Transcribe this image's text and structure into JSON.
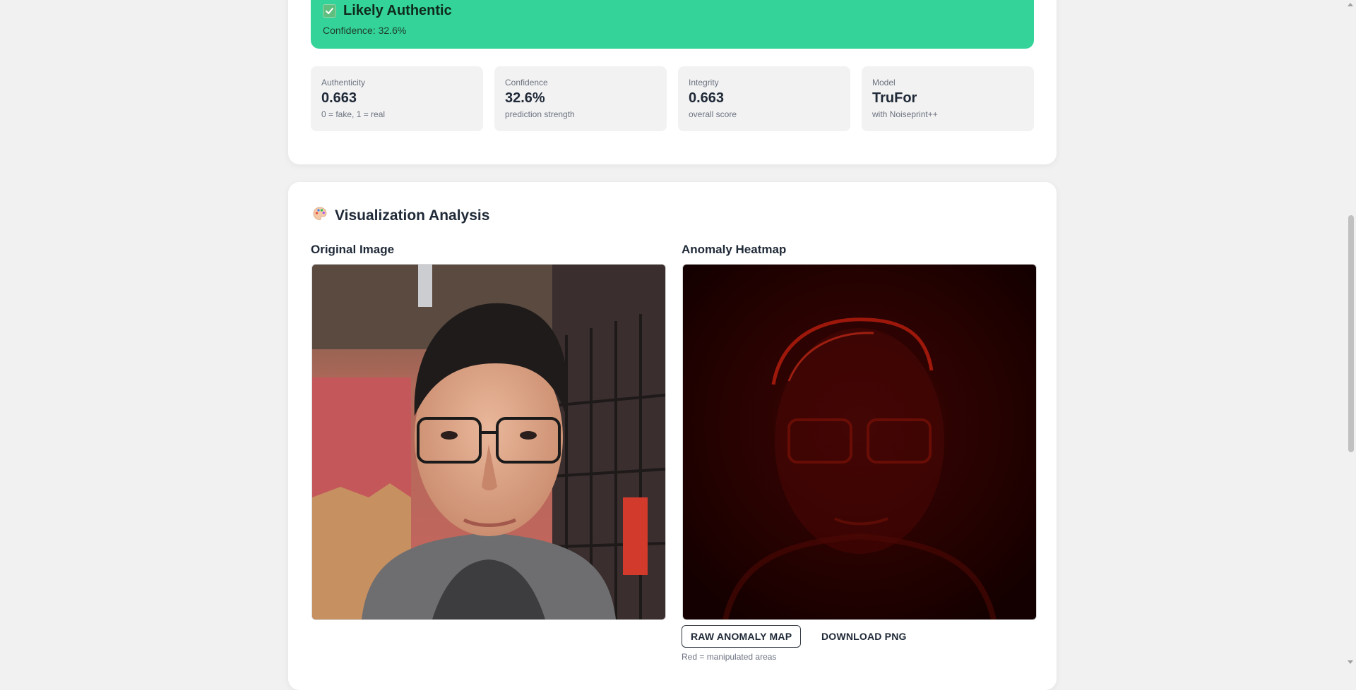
{
  "verdict": {
    "title": "Likely Authentic",
    "confidence_text": "Confidence: 32.6%",
    "icon": "check-icon",
    "color": "#34d399"
  },
  "stats": [
    {
      "label": "Authenticity",
      "value": "0.663",
      "sub": "0 = fake, 1 = real"
    },
    {
      "label": "Confidence",
      "value": "32.6%",
      "sub": "prediction strength"
    },
    {
      "label": "Integrity",
      "value": "0.663",
      "sub": "overall score"
    },
    {
      "label": "Model",
      "value": "TruFor",
      "sub": "with Noiseprint++"
    }
  ],
  "visualization": {
    "icon": "palette-icon",
    "title": "Visualization Analysis",
    "original_title": "Original Image",
    "heatmap_title": "Anomaly Heatmap",
    "raw_button": "RAW ANOMALY MAP",
    "download_button": "DOWNLOAD PNG",
    "caption": "Red = manipulated areas"
  }
}
